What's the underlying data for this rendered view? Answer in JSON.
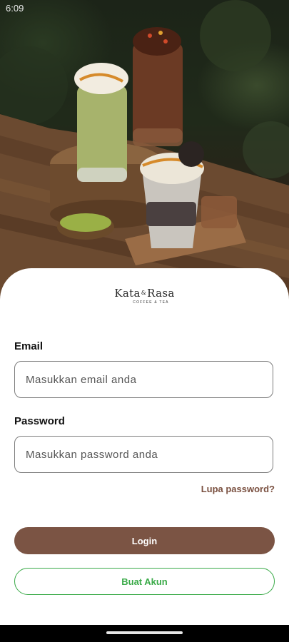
{
  "status_bar": {
    "time": "6:09"
  },
  "brand": {
    "name_left": "Kata",
    "ampersand": "&",
    "name_right": "Rasa",
    "tagline": "COFFEE & TEA"
  },
  "hero_image": {
    "alt": "Matcha latte, chocolate frappe and cookies & cream drink on a wooden table"
  },
  "form": {
    "email_label": "Email",
    "email_placeholder": "Masukkan email anda",
    "password_label": "Password",
    "password_placeholder": "Masukkan password anda",
    "forgot_password": "Lupa password?",
    "login_button": "Login",
    "register_button": "Buat Akun"
  },
  "colors": {
    "primary_brown": "#7b5444",
    "accent_green": "#3aaa48",
    "link_brown": "#7a5040"
  }
}
